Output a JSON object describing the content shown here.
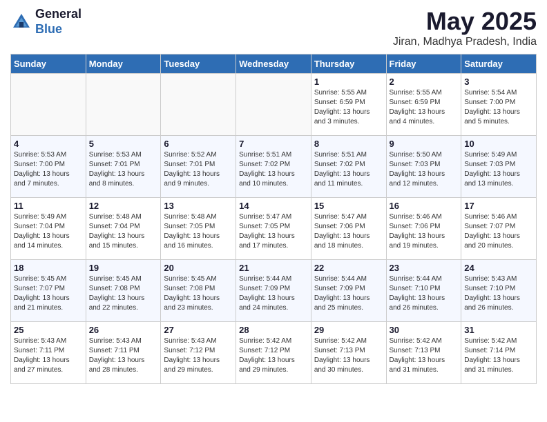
{
  "header": {
    "logo_line1": "General",
    "logo_line2": "Blue",
    "month_title": "May 2025",
    "location": "Jiran, Madhya Pradesh, India"
  },
  "weekdays": [
    "Sunday",
    "Monday",
    "Tuesday",
    "Wednesday",
    "Thursday",
    "Friday",
    "Saturday"
  ],
  "weeks": [
    [
      {
        "day": "",
        "info": ""
      },
      {
        "day": "",
        "info": ""
      },
      {
        "day": "",
        "info": ""
      },
      {
        "day": "",
        "info": ""
      },
      {
        "day": "1",
        "info": "Sunrise: 5:55 AM\nSunset: 6:59 PM\nDaylight: 13 hours\nand 3 minutes."
      },
      {
        "day": "2",
        "info": "Sunrise: 5:55 AM\nSunset: 6:59 PM\nDaylight: 13 hours\nand 4 minutes."
      },
      {
        "day": "3",
        "info": "Sunrise: 5:54 AM\nSunset: 7:00 PM\nDaylight: 13 hours\nand 5 minutes."
      }
    ],
    [
      {
        "day": "4",
        "info": "Sunrise: 5:53 AM\nSunset: 7:00 PM\nDaylight: 13 hours\nand 7 minutes."
      },
      {
        "day": "5",
        "info": "Sunrise: 5:53 AM\nSunset: 7:01 PM\nDaylight: 13 hours\nand 8 minutes."
      },
      {
        "day": "6",
        "info": "Sunrise: 5:52 AM\nSunset: 7:01 PM\nDaylight: 13 hours\nand 9 minutes."
      },
      {
        "day": "7",
        "info": "Sunrise: 5:51 AM\nSunset: 7:02 PM\nDaylight: 13 hours\nand 10 minutes."
      },
      {
        "day": "8",
        "info": "Sunrise: 5:51 AM\nSunset: 7:02 PM\nDaylight: 13 hours\nand 11 minutes."
      },
      {
        "day": "9",
        "info": "Sunrise: 5:50 AM\nSunset: 7:03 PM\nDaylight: 13 hours\nand 12 minutes."
      },
      {
        "day": "10",
        "info": "Sunrise: 5:49 AM\nSunset: 7:03 PM\nDaylight: 13 hours\nand 13 minutes."
      }
    ],
    [
      {
        "day": "11",
        "info": "Sunrise: 5:49 AM\nSunset: 7:04 PM\nDaylight: 13 hours\nand 14 minutes."
      },
      {
        "day": "12",
        "info": "Sunrise: 5:48 AM\nSunset: 7:04 PM\nDaylight: 13 hours\nand 15 minutes."
      },
      {
        "day": "13",
        "info": "Sunrise: 5:48 AM\nSunset: 7:05 PM\nDaylight: 13 hours\nand 16 minutes."
      },
      {
        "day": "14",
        "info": "Sunrise: 5:47 AM\nSunset: 7:05 PM\nDaylight: 13 hours\nand 17 minutes."
      },
      {
        "day": "15",
        "info": "Sunrise: 5:47 AM\nSunset: 7:06 PM\nDaylight: 13 hours\nand 18 minutes."
      },
      {
        "day": "16",
        "info": "Sunrise: 5:46 AM\nSunset: 7:06 PM\nDaylight: 13 hours\nand 19 minutes."
      },
      {
        "day": "17",
        "info": "Sunrise: 5:46 AM\nSunset: 7:07 PM\nDaylight: 13 hours\nand 20 minutes."
      }
    ],
    [
      {
        "day": "18",
        "info": "Sunrise: 5:45 AM\nSunset: 7:07 PM\nDaylight: 13 hours\nand 21 minutes."
      },
      {
        "day": "19",
        "info": "Sunrise: 5:45 AM\nSunset: 7:08 PM\nDaylight: 13 hours\nand 22 minutes."
      },
      {
        "day": "20",
        "info": "Sunrise: 5:45 AM\nSunset: 7:08 PM\nDaylight: 13 hours\nand 23 minutes."
      },
      {
        "day": "21",
        "info": "Sunrise: 5:44 AM\nSunset: 7:09 PM\nDaylight: 13 hours\nand 24 minutes."
      },
      {
        "day": "22",
        "info": "Sunrise: 5:44 AM\nSunset: 7:09 PM\nDaylight: 13 hours\nand 25 minutes."
      },
      {
        "day": "23",
        "info": "Sunrise: 5:44 AM\nSunset: 7:10 PM\nDaylight: 13 hours\nand 26 minutes."
      },
      {
        "day": "24",
        "info": "Sunrise: 5:43 AM\nSunset: 7:10 PM\nDaylight: 13 hours\nand 26 minutes."
      }
    ],
    [
      {
        "day": "25",
        "info": "Sunrise: 5:43 AM\nSunset: 7:11 PM\nDaylight: 13 hours\nand 27 minutes."
      },
      {
        "day": "26",
        "info": "Sunrise: 5:43 AM\nSunset: 7:11 PM\nDaylight: 13 hours\nand 28 minutes."
      },
      {
        "day": "27",
        "info": "Sunrise: 5:43 AM\nSunset: 7:12 PM\nDaylight: 13 hours\nand 29 minutes."
      },
      {
        "day": "28",
        "info": "Sunrise: 5:42 AM\nSunset: 7:12 PM\nDaylight: 13 hours\nand 29 minutes."
      },
      {
        "day": "29",
        "info": "Sunrise: 5:42 AM\nSunset: 7:13 PM\nDaylight: 13 hours\nand 30 minutes."
      },
      {
        "day": "30",
        "info": "Sunrise: 5:42 AM\nSunset: 7:13 PM\nDaylight: 13 hours\nand 31 minutes."
      },
      {
        "day": "31",
        "info": "Sunrise: 5:42 AM\nSunset: 7:14 PM\nDaylight: 13 hours\nand 31 minutes."
      }
    ]
  ]
}
